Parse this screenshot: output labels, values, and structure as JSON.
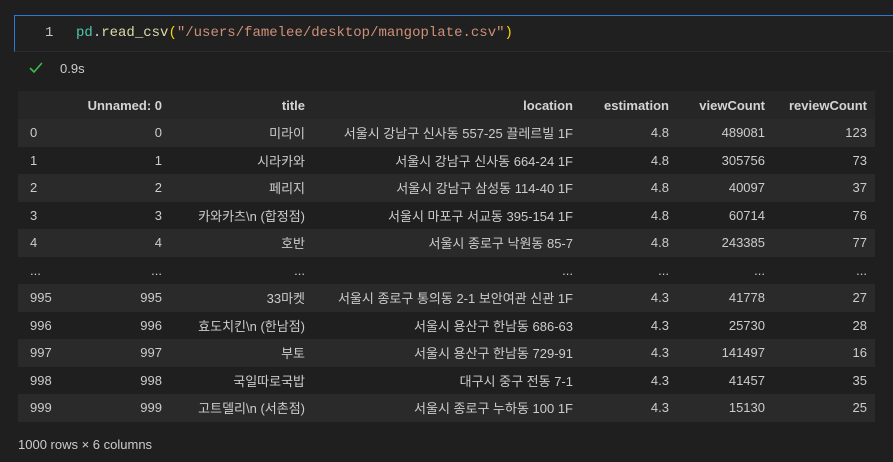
{
  "cell": {
    "line_number": "1",
    "code": {
      "var": "pd",
      "dot": ".",
      "fn": "read_csv",
      "open": "(",
      "str": "\"/users/famelee/desktop/mangoplate.csv\"",
      "close": ")"
    },
    "status_icon": "check-icon",
    "elapsed": "0.9s",
    "status_color": "#3fb950"
  },
  "table": {
    "columns": [
      "",
      "Unnamed: 0",
      "title",
      "location",
      "estimation",
      "viewCount",
      "reviewCount"
    ],
    "rows": [
      [
        "0",
        "0",
        "미라이",
        "서울시 강남구 신사동 557-25 끌레르빌 1F",
        "4.8",
        "489081",
        "123"
      ],
      [
        "1",
        "1",
        "시라카와",
        "서울시 강남구 신사동 664-24 1F",
        "4.8",
        "305756",
        "73"
      ],
      [
        "2",
        "2",
        "페리지",
        "서울시 강남구 삼성동 114-40 1F",
        "4.8",
        "40097",
        "37"
      ],
      [
        "3",
        "3",
        "카와카츠\\n (합정점)",
        "서울시 마포구 서교동 395-154 1F",
        "4.8",
        "60714",
        "76"
      ],
      [
        "4",
        "4",
        "호반",
        "서울시 종로구 낙원동 85-7",
        "4.8",
        "243385",
        "77"
      ],
      [
        "...",
        "...",
        "...",
        "...",
        "...",
        "...",
        "..."
      ],
      [
        "995",
        "995",
        "33마켓",
        "서울시 종로구 통의동 2-1 보안여관 신관 1F",
        "4.3",
        "41778",
        "27"
      ],
      [
        "996",
        "996",
        "효도치킨\\n (한남점)",
        "서울시 용산구 한남동 686-63",
        "4.3",
        "25730",
        "28"
      ],
      [
        "997",
        "997",
        "부토",
        "서울시 용산구 한남동 729-91",
        "4.3",
        "141497",
        "16"
      ],
      [
        "998",
        "998",
        "국일따로국밥",
        "대구시 중구 전동 7-1",
        "4.3",
        "41457",
        "35"
      ],
      [
        "999",
        "999",
        "고트델리\\n (서촌점)",
        "서울시 종로구 누하동 100 1F",
        "4.3",
        "15130",
        "25"
      ]
    ]
  },
  "footer": "1000 rows × 6 columns"
}
